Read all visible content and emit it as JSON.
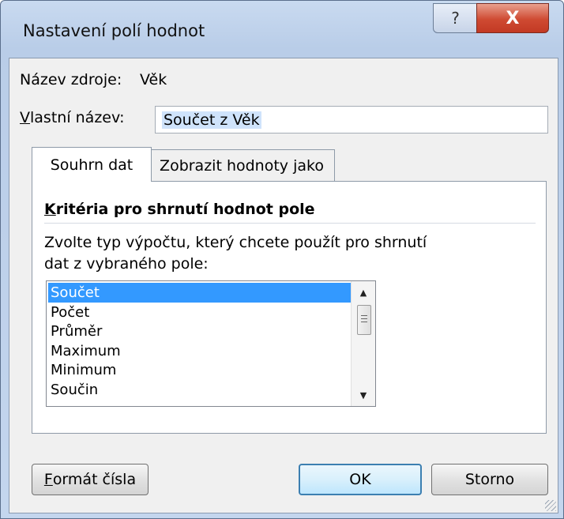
{
  "window": {
    "title": "Nastavení polí hodnot",
    "help_label": "?",
    "close_label": "X"
  },
  "source": {
    "label": "Název zdroje:",
    "value": "Věk"
  },
  "custom_name": {
    "label_accel": "V",
    "label_rest": "lastní název:",
    "value": "Součet z Věk"
  },
  "tabs": [
    {
      "label": "Souhrn dat",
      "active": true
    },
    {
      "label": "Zobrazit hodnoty jako",
      "active": false
    }
  ],
  "summary": {
    "title_accel": "K",
    "title_rest": "ritéria pro shrnutí hodnot pole",
    "description_line1": "Zvolte typ výpočtu, který chcete použít pro shrnutí",
    "description_line2": "dat z vybraného pole:",
    "functions": [
      "Součet",
      "Počet",
      "Průměr",
      "Maximum",
      "Minimum",
      "Součin"
    ],
    "selected_index": 0
  },
  "buttons": {
    "number_format_accel": "F",
    "number_format_rest": "ormát čísla",
    "ok": "OK",
    "cancel": "Storno"
  },
  "icons": {
    "scroll_up": "▲",
    "scroll_down": "▼"
  }
}
